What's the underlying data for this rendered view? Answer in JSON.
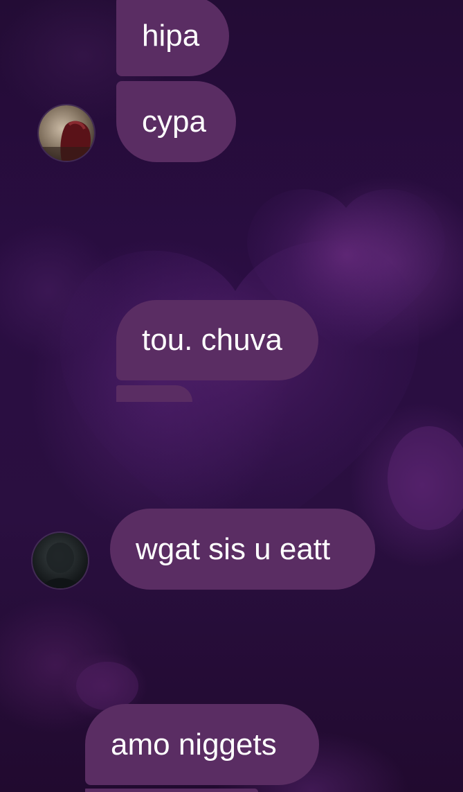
{
  "messages": [
    {
      "text": "hipa"
    },
    {
      "text": "cypa"
    },
    {
      "text": "tou. chuva"
    },
    {
      "text": "wgat sis u eatt"
    },
    {
      "text": "amo niggets"
    }
  ],
  "colors": {
    "bubble": "#5a2d63",
    "background": "#2a0d42",
    "text": "#ffffff"
  },
  "avatars": [
    {
      "icon": "profile-photo-red"
    },
    {
      "icon": "profile-photo-dark"
    }
  ]
}
